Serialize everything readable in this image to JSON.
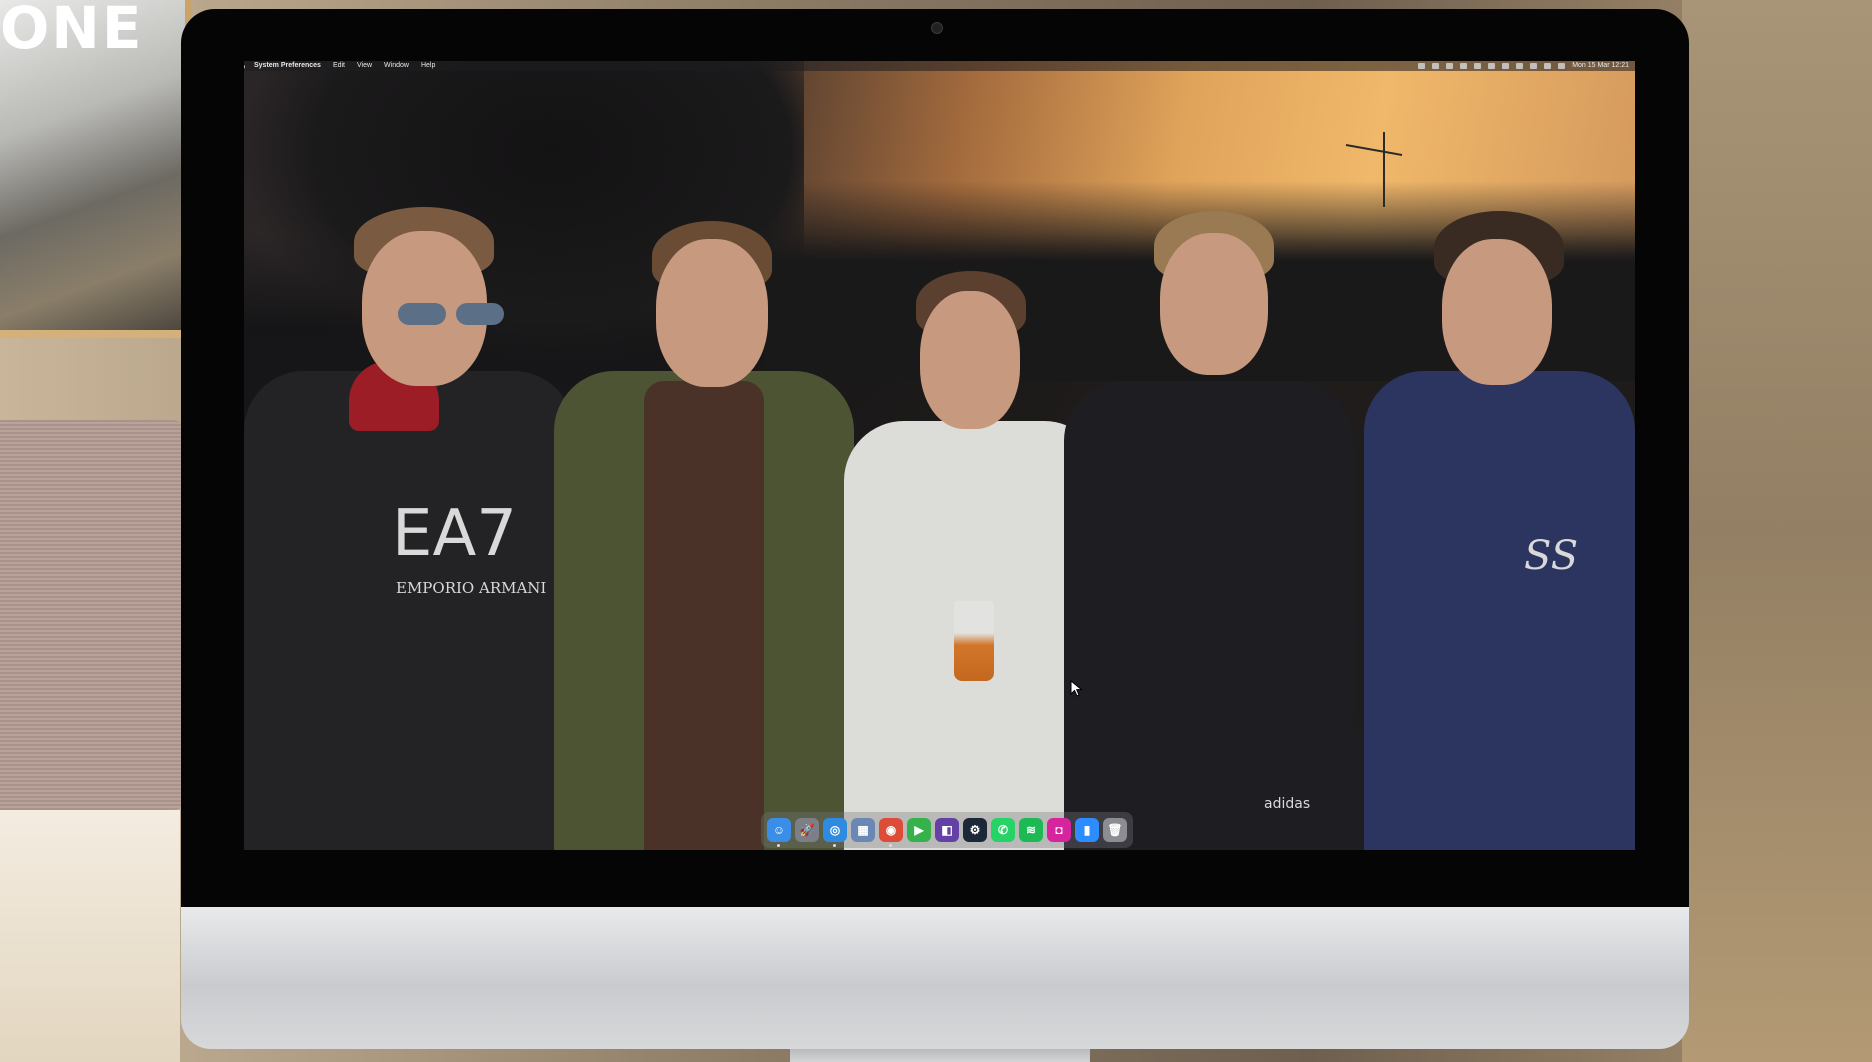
{
  "room": {
    "poster_text": "ONE"
  },
  "menubar": {
    "app_name": "System Preferences",
    "menus": [
      "Edit",
      "View",
      "Window",
      "Help"
    ],
    "clock": "Mon 15 Mar 12:21"
  },
  "wallpaper": {
    "shirt_logo": "EA7",
    "shirt_brand": "EMPORIO ARMANI",
    "hoodie_logo": "SS",
    "pants_logo": "adidas"
  },
  "dock": {
    "apps": [
      {
        "name": "finder-icon",
        "glyph": "☺",
        "color": "#3b8ee8",
        "running": true
      },
      {
        "name": "launchpad-icon",
        "glyph": "🚀",
        "color": "#7a7f88",
        "running": false
      },
      {
        "name": "safari-icon",
        "glyph": "◎",
        "color": "#2f8be0",
        "running": true
      },
      {
        "name": "preview-icon",
        "glyph": "▦",
        "color": "#6b88b5",
        "running": false
      },
      {
        "name": "chrome-icon",
        "glyph": "◉",
        "color": "#dd4b39",
        "running": true
      },
      {
        "name": "facetime-icon",
        "glyph": "▶",
        "color": "#35b34a",
        "running": false
      },
      {
        "name": "twitch-icon",
        "glyph": "◧",
        "color": "#6441a4",
        "running": false
      },
      {
        "name": "steam-icon",
        "glyph": "⚙",
        "color": "#1b2838",
        "running": false
      },
      {
        "name": "whatsapp-icon",
        "glyph": "✆",
        "color": "#25d366",
        "running": false
      },
      {
        "name": "spotify-icon",
        "glyph": "≋",
        "color": "#1db954",
        "running": false
      },
      {
        "name": "instagram-icon",
        "glyph": "◘",
        "color": "#d6249f",
        "running": false
      },
      {
        "name": "zoom-icon",
        "glyph": "▮",
        "color": "#2d8cff",
        "running": false
      },
      {
        "name": "trash-icon",
        "glyph": "🗑",
        "color": "#8b8d92",
        "running": false
      }
    ]
  }
}
